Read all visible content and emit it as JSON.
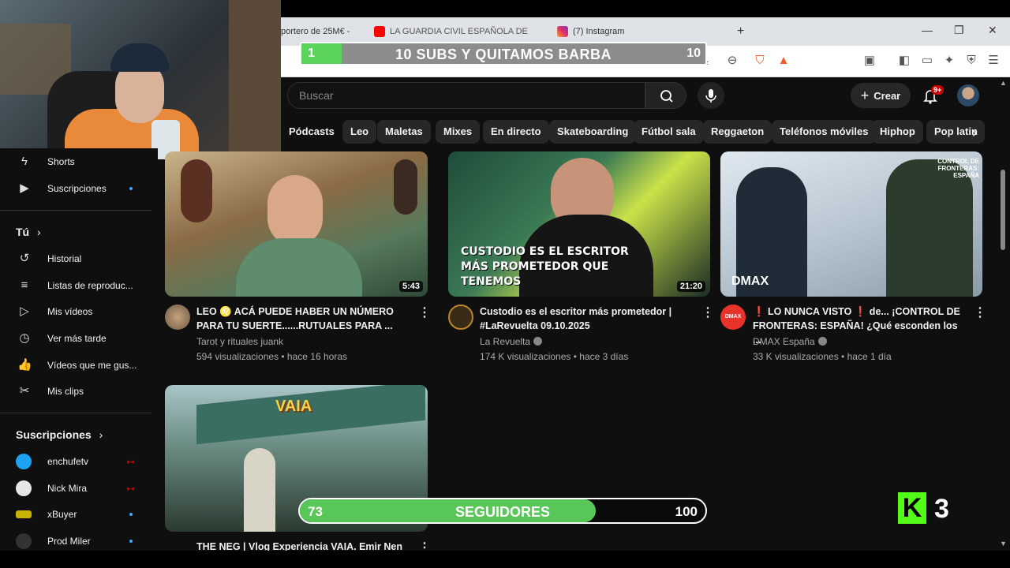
{
  "browser": {
    "tabs": [
      {
        "label": "portero de 25M€ -"
      },
      {
        "label": "LA GUARDIA CIVIL ESPAÑOLA DE"
      },
      {
        "label": "(7) Instagram"
      }
    ],
    "new_tab": "+"
  },
  "overlay": {
    "subs_goal": {
      "current": "1",
      "target": "10",
      "title": "10 SUBS Y QUITAMOS BARBA",
      "progress": 0.1
    },
    "followers": {
      "current": "73",
      "target": "100",
      "title": "SEGUIDORES",
      "progress": 0.73
    },
    "kick": {
      "brand": "K",
      "count": "3"
    }
  },
  "youtube": {
    "search": {
      "placeholder": "Buscar"
    },
    "create_label": "Crear",
    "notif_badge": "9+",
    "chips": [
      "Pódcasts",
      "Leo",
      "Maletas",
      "Mixes",
      "En directo",
      "Skateboarding",
      "Fútbol sala",
      "Reggaeton",
      "Teléfonos móviles",
      "Hiphop",
      "Pop latin"
    ],
    "sidebar": {
      "top_items": [
        {
          "label": "Shorts",
          "icon": "shorts-icon"
        },
        {
          "label": "Suscripciones",
          "icon": "subscriptions-icon"
        }
      ],
      "you_header": "Tú",
      "you_items": [
        {
          "label": "Historial",
          "icon": "history-icon"
        },
        {
          "label": "Listas de reproduc...",
          "icon": "playlist-icon"
        },
        {
          "label": "Mis vídeos",
          "icon": "my-videos-icon"
        },
        {
          "label": "Ver más tarde",
          "icon": "clock-icon"
        },
        {
          "label": "Vídeos que me gus...",
          "icon": "thumbs-up-icon"
        },
        {
          "label": "Mis clips",
          "icon": "scissors-icon"
        }
      ],
      "subs_header": "Suscripciones",
      "subscriptions": [
        {
          "label": "enchufetv",
          "color": "#1da1f2"
        },
        {
          "label": "Nick Mira",
          "color": "#e6e6e6"
        },
        {
          "label": "xBuyer",
          "color": "#c8b400"
        },
        {
          "label": "Prod Miler",
          "color": "#333333"
        }
      ]
    },
    "videos": [
      {
        "title": "LEO ♌ ACÁ PUEDE HABER UN NÚMERO PARA TU SUERTE......RUTUALES PARA ...",
        "channel": "Tarot y rituales juank",
        "meta": "594 visualizaciones • hace 16 horas",
        "duration": "5:43"
      },
      {
        "title": "Custodio es el escritor más prometedor | #LaRevuelta 09.10.2025",
        "channel": "La Revuelta",
        "meta": "174 K visualizaciones • hace 3 días",
        "duration": "21:20",
        "thumb_text": "CUSTODIO ES EL ESCRITOR MÁS PROMETEDOR QUE TENEMOS"
      },
      {
        "title": "❗ LO NUNCA VISTO ❗ de... ¡CONTROL DE FRONTERAS: ESPAÑA! ¿Qué esconden los ...",
        "channel": "DMAX España",
        "meta": "33 K visualizaciones • hace 1 día",
        "thumb_text": "CONTROL DE FRONTERAS: ESPAÑA",
        "thumb_brand": "DMAX",
        "avatar_text": "DMAX"
      },
      {
        "title": "THE NEG | Vlog Experiencia VAIA. Emir Nen",
        "thumb_text": "VAIA"
      }
    ]
  }
}
